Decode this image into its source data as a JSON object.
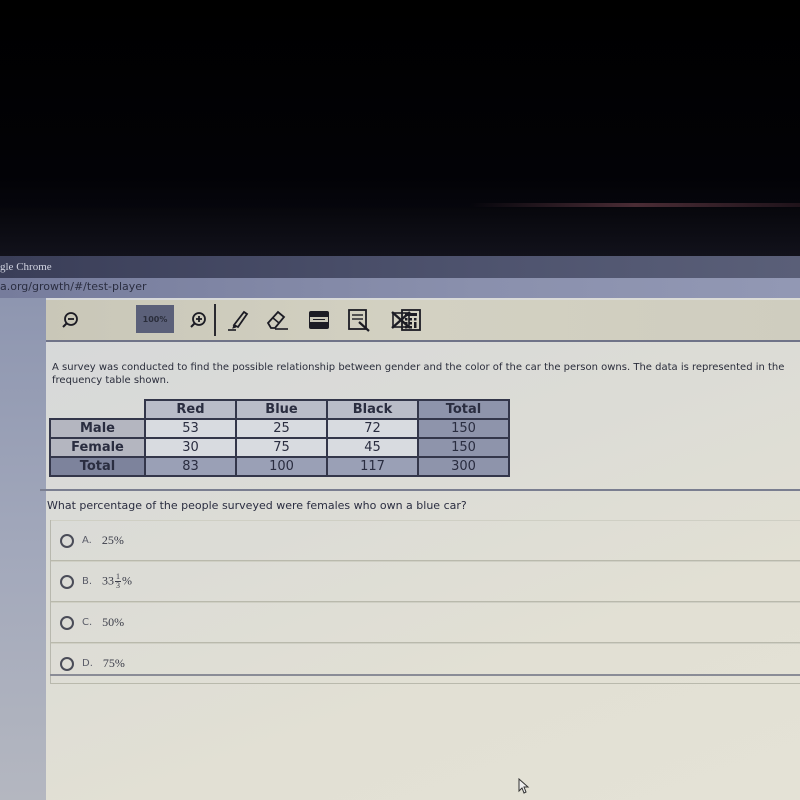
{
  "browser": {
    "title": "gle Chrome",
    "url": "a.org/growth/#/test-player"
  },
  "toolbar": {
    "zoom_level": "100%",
    "tools": [
      {
        "name": "zoom-out-icon"
      },
      {
        "name": "zoom-in-icon"
      },
      {
        "name": "highlighter-icon"
      },
      {
        "name": "eraser-icon"
      },
      {
        "name": "line-reader-icon"
      },
      {
        "name": "notepad-icon"
      },
      {
        "name": "answer-eliminator-icon"
      },
      {
        "name": "calculator-icon"
      }
    ]
  },
  "question": {
    "stem": "A survey was conducted to find the possible relationship between gender and the color of the car the person owns. The data is represented in the frequency table shown.",
    "prompt": "What percentage of the people surveyed were females who own a blue car?"
  },
  "table": {
    "columns": [
      "Red",
      "Blue",
      "Black",
      "Total"
    ],
    "rows": [
      {
        "label": "Male",
        "values": [
          "53",
          "25",
          "72",
          "150"
        ]
      },
      {
        "label": "Female",
        "values": [
          "30",
          "75",
          "45",
          "150"
        ]
      },
      {
        "label": "Total",
        "values": [
          "83",
          "100",
          "117",
          "300"
        ]
      }
    ]
  },
  "choices": [
    {
      "letter": "A.",
      "value": "25%"
    },
    {
      "letter": "B.",
      "whole": "33",
      "numerator": "1",
      "denominator": "3",
      "suffix": "%"
    },
    {
      "letter": "C.",
      "value": "50%"
    },
    {
      "letter": "D.",
      "value": "75%"
    }
  ]
}
